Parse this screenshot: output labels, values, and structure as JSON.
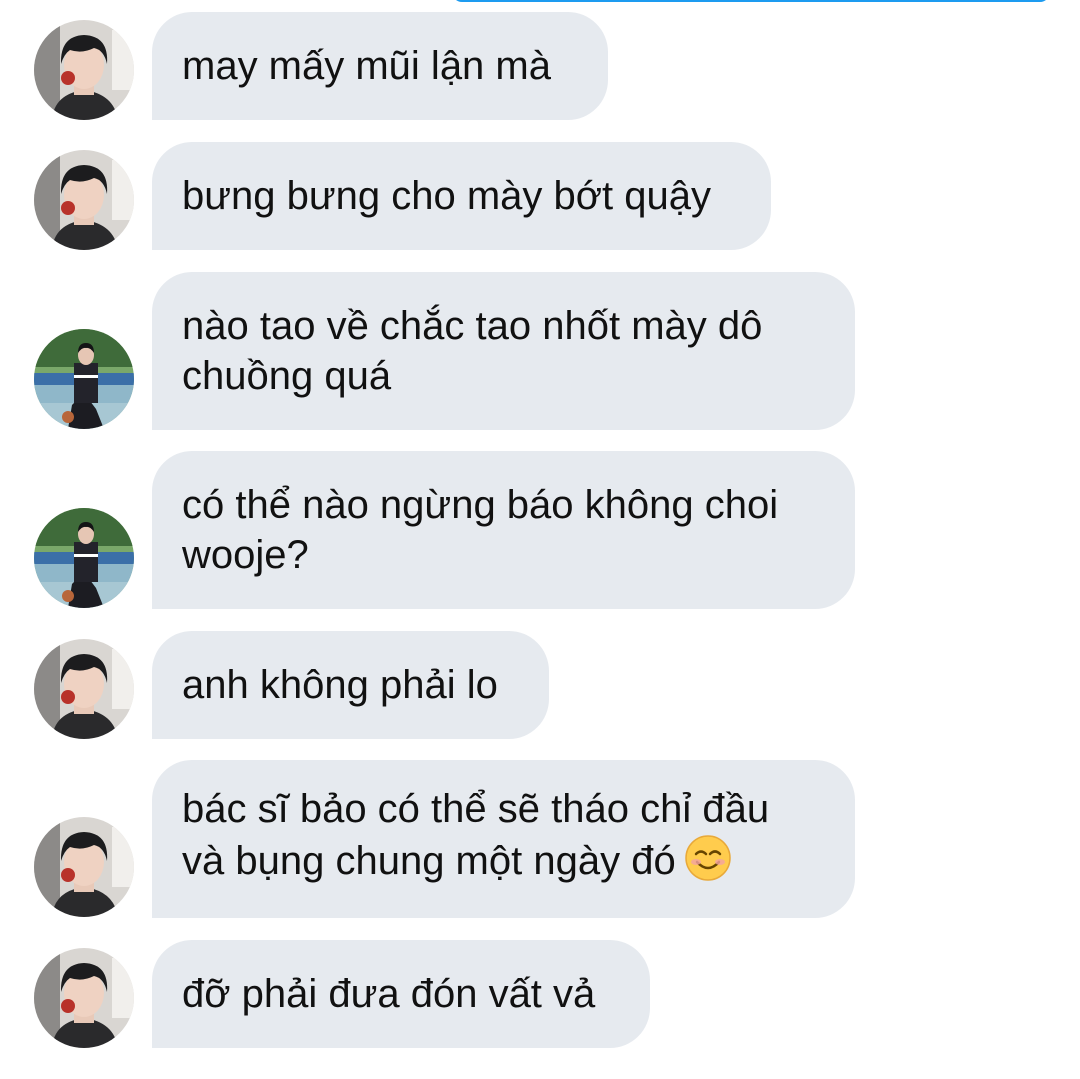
{
  "thread": {
    "messages": [
      {
        "sender": "user-a",
        "text": "may mấy mũi lận mà"
      },
      {
        "sender": "user-a",
        "text": "bưng bưng cho mày bớt quậy"
      },
      {
        "sender": "user-b",
        "text": "nào tao về chắc tao nhốt mày dô\nchuồng quá"
      },
      {
        "sender": "user-b",
        "text": "có thể nào ngừng báo không choi\nwooje?"
      },
      {
        "sender": "user-a",
        "text": "anh không phải lo"
      },
      {
        "sender": "user-a",
        "text": "bác sĩ bảo có thể sẽ tháo chỉ đầu\nvà bụng chung một ngày đó",
        "emoji": "smiling-face-emoji"
      },
      {
        "sender": "user-a",
        "text": "đỡ phải đưa đón vất vả"
      }
    ]
  },
  "colors": {
    "bubble_background": "#e6eaef",
    "text": "#111111",
    "accent": "#1d9bf0"
  }
}
